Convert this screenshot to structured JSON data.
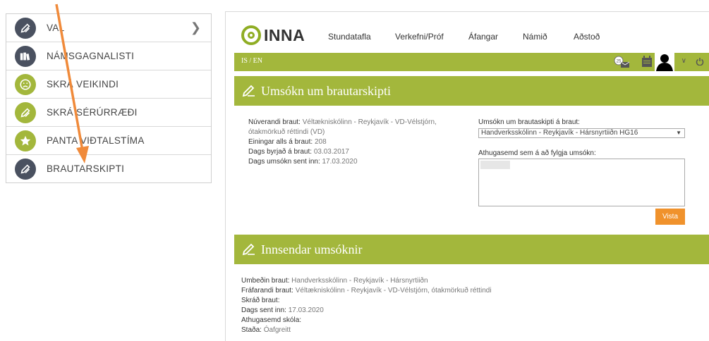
{
  "left_menu": {
    "items": [
      {
        "label": "VAL",
        "icon": "pencil-icon"
      },
      {
        "label": "NÁMSGAGNALISTI",
        "icon": "books-icon"
      },
      {
        "label": "SKRÁ VEIKINDI",
        "icon": "sad-face-icon"
      },
      {
        "label": "SKRÁ SÉRÚRRÆÐI",
        "icon": "pencil-icon"
      },
      {
        "label": "PANTA VIÐTALSTÍMA",
        "icon": "star-icon"
      },
      {
        "label": "BRAUTARSKIPTI",
        "icon": "pencil-icon"
      }
    ]
  },
  "app": {
    "logo": "INNA",
    "nav": [
      "Stundatafla",
      "Verkefni/Próf",
      "Áfangar",
      "Námið",
      "Aðstoð"
    ],
    "lang": "IS / EN",
    "badge": "25",
    "section1": {
      "title": "Umsókn um brautarskipti",
      "current_track_label": "Núverandi braut:",
      "current_track_value": "Véltækniskólinn - Reykjavík - VD-Vélstjórn,",
      "current_track_value2": "ótakmörkuð réttindi (VD)",
      "units_label": "Einingar alls á braut:",
      "units_value": "208",
      "start_label": "Dags byrjað á braut:",
      "start_value": "03.03.2017",
      "sent_label": "Dags umsókn sent inn:",
      "sent_value": "17.03.2020",
      "select_label": "Umsókn um brautaskipti á braut:",
      "select_value": "Handverksskólinn - Reykjavík - Hársnyrtiiðn HG16",
      "comment_label": "Athugasemd sem á að fylgja umsókn:",
      "save_label": "Vista"
    },
    "section2": {
      "title": "Innsendar umsóknir",
      "requested_label": "Umbeðin braut:",
      "requested_value": "Handverksskólinn - Reykjavík - Hársnyrtiiðn",
      "leaving_label": "Fráfarandi braut:",
      "leaving_value": "Véltækniskólinn - Reykjavík - VD-Vélstjórn, ótakmörkuð réttindi",
      "registered_label": "Skráð braut:",
      "sent_label": "Dags sent inn:",
      "sent_value": "17.03.2020",
      "school_comment_label": "Athugasemd skóla:",
      "status_label": "Staða:",
      "status_value": "Óafgreitt"
    }
  },
  "colors": {
    "accent_green": "#a3b73c",
    "orange": "#f0922c",
    "icon_dark": "#4a5160"
  }
}
